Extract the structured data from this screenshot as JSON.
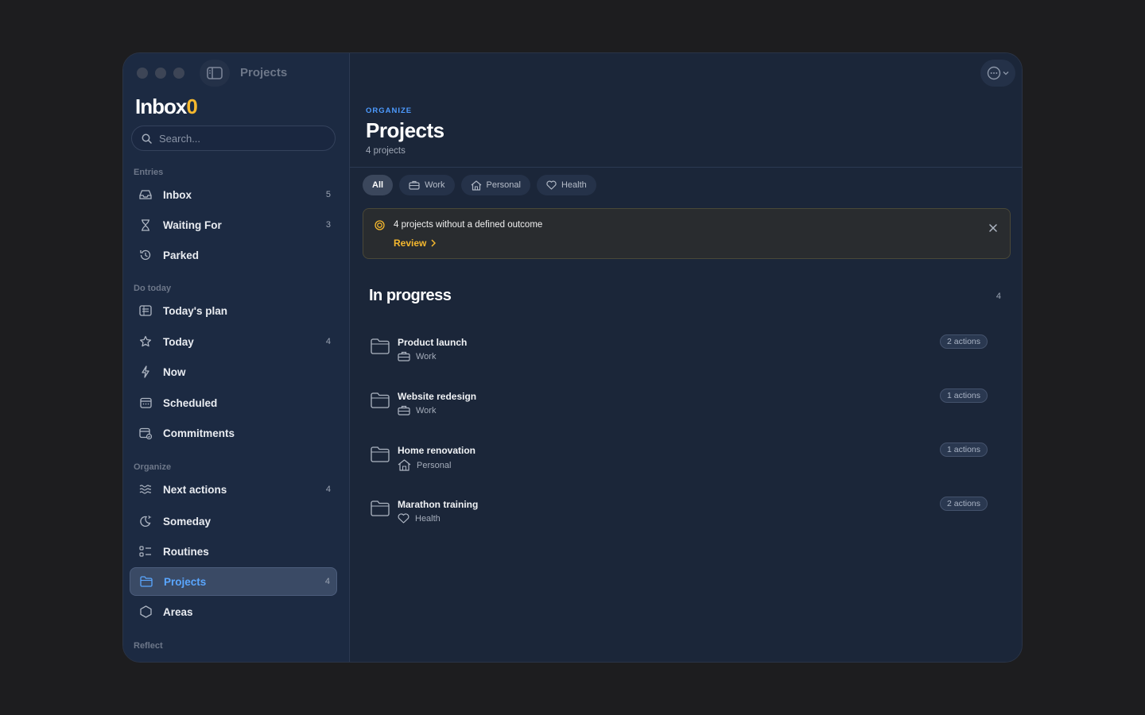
{
  "window": {
    "title": "Projects"
  },
  "sidebar": {
    "logo_main": "Inbox",
    "logo_accent": "0",
    "search_placeholder": "Search...",
    "sections": {
      "entries": "Entries",
      "do_today": "Do today",
      "organize": "Organize",
      "reflect": "Reflect"
    },
    "items": [
      {
        "label": "Inbox",
        "count": "5",
        "icon": "inbox-icon"
      },
      {
        "label": "Waiting For",
        "count": "3",
        "icon": "hourglass-icon"
      },
      {
        "label": "Parked",
        "count": "",
        "icon": "history-icon"
      },
      {
        "label": "Today's plan",
        "count": "",
        "icon": "plan-list-icon"
      },
      {
        "label": "Today",
        "count": "4",
        "icon": "star-icon"
      },
      {
        "label": "Now",
        "count": "",
        "icon": "bolt-icon"
      },
      {
        "label": "Scheduled",
        "count": "",
        "icon": "calendar-icon"
      },
      {
        "label": "Commitments",
        "count": "",
        "icon": "calendar-check-icon"
      },
      {
        "label": "Next actions",
        "count": "4",
        "icon": "waves-icon"
      },
      {
        "label": "Someday",
        "count": "",
        "icon": "moon-icon"
      },
      {
        "label": "Routines",
        "count": "",
        "icon": "checklist-icon"
      },
      {
        "label": "Projects",
        "count": "4",
        "icon": "folder-icon",
        "active": true
      },
      {
        "label": "Areas",
        "count": "",
        "icon": "hexagon-icon"
      }
    ]
  },
  "main": {
    "eyebrow": "ORGANIZE",
    "title": "Projects",
    "subtitle": "4 projects",
    "filters": [
      {
        "label": "All",
        "active": true
      },
      {
        "label": "Work",
        "icon": "briefcase-icon"
      },
      {
        "label": "Personal",
        "icon": "home-icon"
      },
      {
        "label": "Health",
        "icon": "heart-icon"
      }
    ],
    "banner": {
      "text": "4 projects without a defined outcome",
      "action": "Review"
    },
    "group": {
      "title": "In progress",
      "count": "4"
    },
    "projects": [
      {
        "name": "Product launch",
        "area": "Work",
        "area_icon": "briefcase-icon",
        "actions": "2 actions"
      },
      {
        "name": "Website redesign",
        "area": "Work",
        "area_icon": "briefcase-icon",
        "actions": "1 actions"
      },
      {
        "name": "Home renovation",
        "area": "Personal",
        "area_icon": "home-icon",
        "actions": "1 actions"
      },
      {
        "name": "Marathon training",
        "area": "Health",
        "area_icon": "heart-icon",
        "actions": "2 actions"
      }
    ]
  },
  "colors": {
    "accent_blue": "#4d9bff",
    "accent_yellow": "#f5b82e",
    "background": "#1b2639",
    "sidebar": "#1c2a42"
  }
}
